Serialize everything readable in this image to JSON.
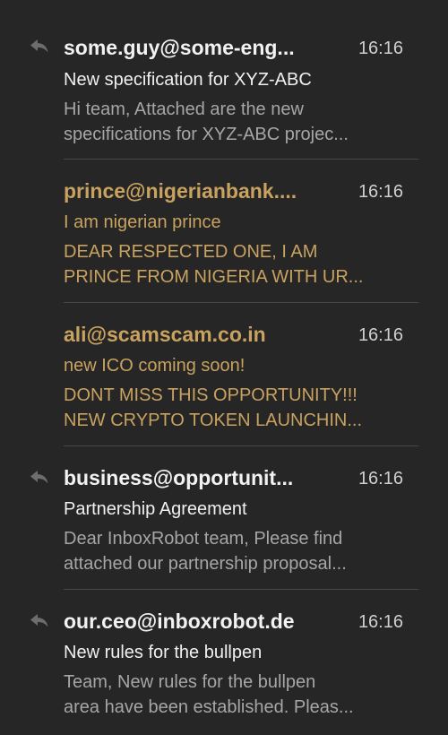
{
  "accent_spam_color": "#c9a260",
  "emails": [
    {
      "sender": "some.guy@some-eng...",
      "time": "16:16",
      "subject": "New specification for XYZ-ABC",
      "preview_line1": "Hi team, Attached are the new",
      "preview_line2": "specifications for XYZ-ABC projec...",
      "replied": true,
      "icon": "reply-icon"
    },
    {
      "sender": "prince@nigerianbank....",
      "time": "16:16",
      "subject": "I am nigerian prince",
      "preview_line1": "DEAR RESPECTED ONE, I AM",
      "preview_line2": "PRINCE FROM NIGERIA WITH UR...",
      "replied": false,
      "spam": true
    },
    {
      "sender": "ali@scamscam.co.in",
      "time": "16:16",
      "subject": "new ICO coming soon!",
      "preview_line1": "DONT MISS THIS OPPORTUNITY!!!",
      "preview_line2": "NEW CRYPTO TOKEN LAUNCHIN...",
      "replied": false,
      "spam": true
    },
    {
      "sender": "business@opportunit...",
      "time": "16:16",
      "subject": "Partnership Agreement",
      "preview_line1": "Dear InboxRobot team, Please find",
      "preview_line2": "attached our partnership proposal...",
      "replied": true,
      "icon": "reply-icon"
    },
    {
      "sender": "our.ceo@inboxrobot.de",
      "time": "16:16",
      "subject": "New rules for the bullpen",
      "preview_line1": "Team, New rules for the bullpen",
      "preview_line2": "area have been established. Pleas...",
      "replied": true,
      "icon": "reply-icon"
    }
  ]
}
